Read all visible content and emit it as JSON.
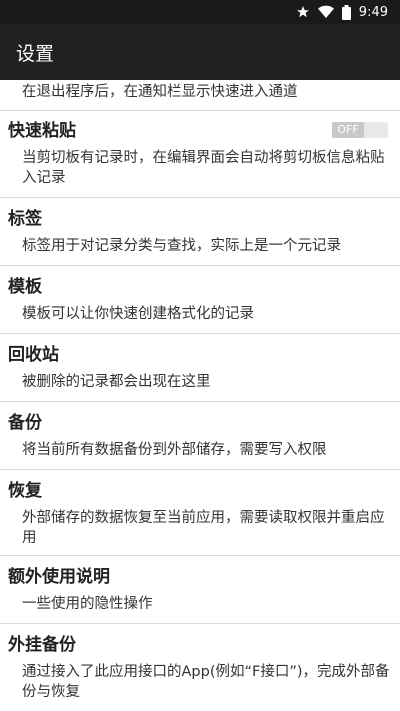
{
  "status_bar": {
    "time": "9:49",
    "icons": [
      "star-icon",
      "wifi-icon",
      "battery-icon"
    ]
  },
  "app_bar": {
    "title": "设置"
  },
  "items": [
    {
      "title": "",
      "desc": "在退出程序后，在通知栏显示快速进入通道"
    },
    {
      "title": "快速粘贴",
      "desc": "当剪切板有记录时，在编辑界面会自动将剪切板信息粘贴入记录",
      "toggle": "OFF"
    },
    {
      "title": "标签",
      "desc": "标签用于对记录分类与查找，实际上是一个元记录"
    },
    {
      "title": "模板",
      "desc": "模板可以让你快速创建格式化的记录"
    },
    {
      "title": "回收站",
      "desc": "被删除的记录都会出现在这里"
    },
    {
      "title": "备份",
      "desc": "将当前所有数据备份到外部储存，需要写入权限"
    },
    {
      "title": "恢复",
      "desc": "外部储存的数据恢复至当前应用，需要读取权限并重启应用"
    },
    {
      "title": "额外使用说明",
      "desc": "一些使用的隐性操作"
    },
    {
      "title": "外挂备份",
      "desc": "通过接入了此应用接口的App(例如“F接口”)，完成外部备份与恢复"
    }
  ]
}
